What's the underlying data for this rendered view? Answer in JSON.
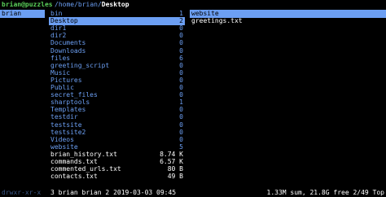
{
  "topbar": {
    "user": "brian@puzzles",
    "path": "/home/brian/",
    "current": "Desktop"
  },
  "col0": [
    {
      "name": "brian",
      "selected": true
    }
  ],
  "col1": [
    {
      "name": "bin",
      "size": "1",
      "type": "dir"
    },
    {
      "name": "Desktop",
      "size": "2",
      "type": "dir",
      "selected": true
    },
    {
      "name": "dir1",
      "size": "0",
      "type": "dir"
    },
    {
      "name": "dir2",
      "size": "0",
      "type": "dir"
    },
    {
      "name": "Documents",
      "size": "0",
      "type": "dir"
    },
    {
      "name": "Downloads",
      "size": "0",
      "type": "dir"
    },
    {
      "name": "files",
      "size": "6",
      "type": "dir"
    },
    {
      "name": "greeting_script",
      "size": "0",
      "type": "dir"
    },
    {
      "name": "Music",
      "size": "0",
      "type": "dir"
    },
    {
      "name": "Pictures",
      "size": "0",
      "type": "dir"
    },
    {
      "name": "Public",
      "size": "0",
      "type": "dir"
    },
    {
      "name": "secret_files",
      "size": "0",
      "type": "dir"
    },
    {
      "name": "sharptools",
      "size": "1",
      "type": "dir"
    },
    {
      "name": "Templates",
      "size": "0",
      "type": "dir"
    },
    {
      "name": "testdir",
      "size": "0",
      "type": "dir"
    },
    {
      "name": "testsite",
      "size": "0",
      "type": "dir"
    },
    {
      "name": "testsite2",
      "size": "0",
      "type": "dir"
    },
    {
      "name": "Videos",
      "size": "0",
      "type": "dir"
    },
    {
      "name": "website",
      "size": "5",
      "type": "dir"
    },
    {
      "name": "brian_history.txt",
      "size": "8.74 K",
      "type": "file"
    },
    {
      "name": "commands.txt",
      "size": "6.57 K",
      "type": "file"
    },
    {
      "name": "commented_urls.txt",
      "size": "80 B",
      "type": "file"
    },
    {
      "name": "contacts.txt",
      "size": "49 B",
      "type": "file"
    }
  ],
  "col2": [
    {
      "name": "website",
      "type": "dir",
      "selected": true
    },
    {
      "name": "greetings.txt",
      "type": "file"
    }
  ],
  "status": {
    "perms": "drwxr-xr-x",
    "info": "3 brian brian 2 2019-03-03 09:45",
    "right": "1.33M sum, 21.8G free  2/49  Top"
  }
}
